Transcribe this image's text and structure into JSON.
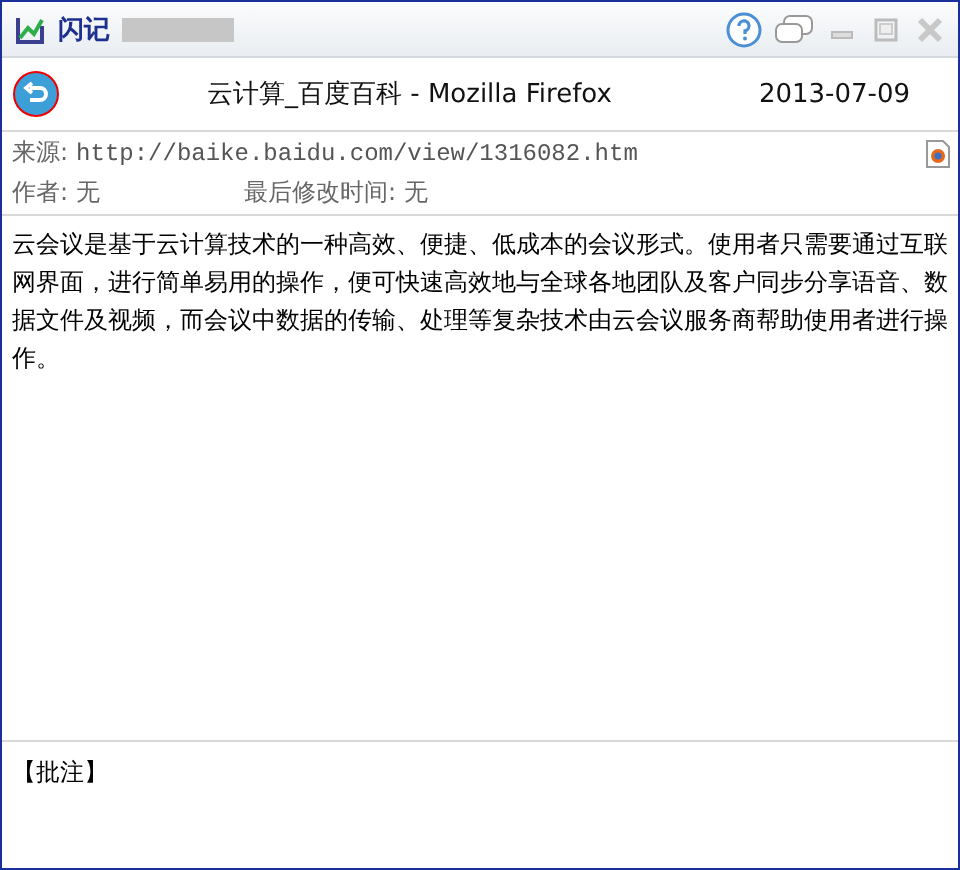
{
  "window": {
    "title": "闪记"
  },
  "header": {
    "title": "云计算_百度百科 - Mozilla Firefox",
    "date": "2013-07-09"
  },
  "meta": {
    "source_label": "来源:",
    "source_url": "http://baike.baidu.com/view/1316082.htm",
    "author_label": "作者:",
    "author": "无",
    "modified_label": "最后修改时间:",
    "modified": "无"
  },
  "body": "云会议是基于云计算技术的一种高效、便捷、低成本的会议形式。使用者只需要通过互联网界面，进行简单易用的操作，便可快速高效地与全球各地团队及客户同步分享语音、数据文件及视频，而会议中数据的传输、处理等复杂技术由云会议服务商帮助使用者进行操作。",
  "annotation": {
    "label": "【批注】"
  }
}
